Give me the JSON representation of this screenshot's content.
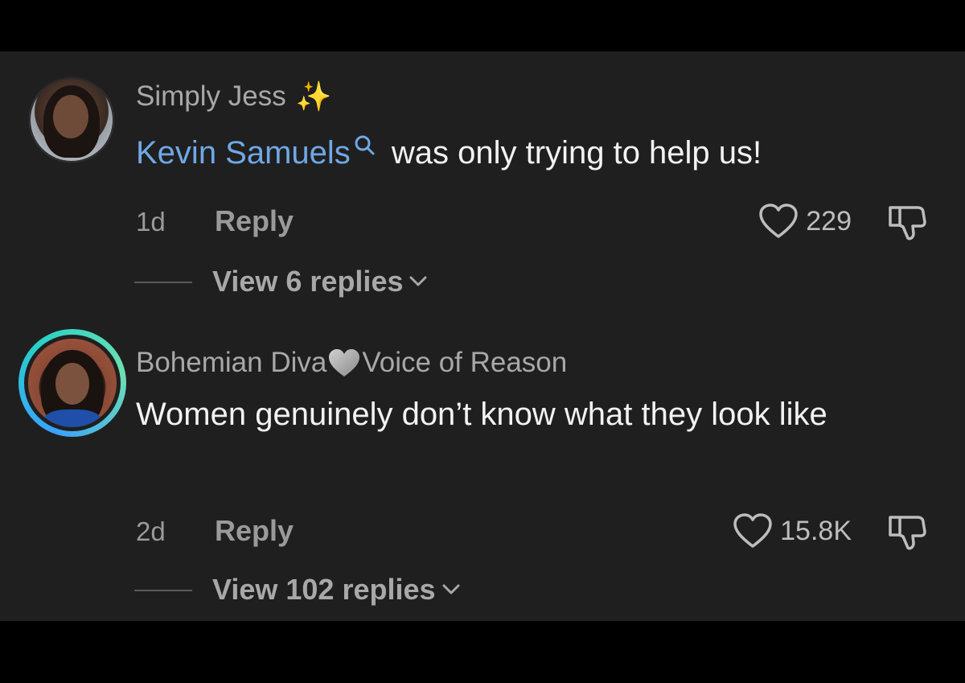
{
  "comments": [
    {
      "username": "Simply Jess",
      "username_emoji": "✨",
      "mention": "Kevin Samuels",
      "text": " was only trying to help us!",
      "time": "1d",
      "reply_label": "Reply",
      "likes": "229",
      "view_replies": "View 6 replies",
      "avatar_icon": "profile-photo",
      "has_story_ring": false
    },
    {
      "username_part1": "Bohemian Diva",
      "username_emoji": "gray-heart",
      "username_part2": "Voice of Reason",
      "text": "Women genuinely don’t know what they look like",
      "time": "2d",
      "reply_label": "Reply",
      "likes": "15.8K",
      "view_replies": "View 102 replies",
      "avatar_icon": "profile-photo",
      "has_story_ring": true
    }
  ],
  "colors": {
    "background": "#1f1f1f",
    "outer_background": "#000000",
    "mention": "#6fa8e6",
    "primary_text": "#f2f2f2",
    "secondary_text": "#a8a8a8",
    "story_ring": [
      "#3aa0ff",
      "#28d1c8",
      "#6ee0b0"
    ]
  },
  "icons": {
    "like": "heart-outline-icon",
    "dislike": "thumbs-down-outline-icon",
    "mention": "search-icon",
    "expand": "chevron-down-icon"
  }
}
